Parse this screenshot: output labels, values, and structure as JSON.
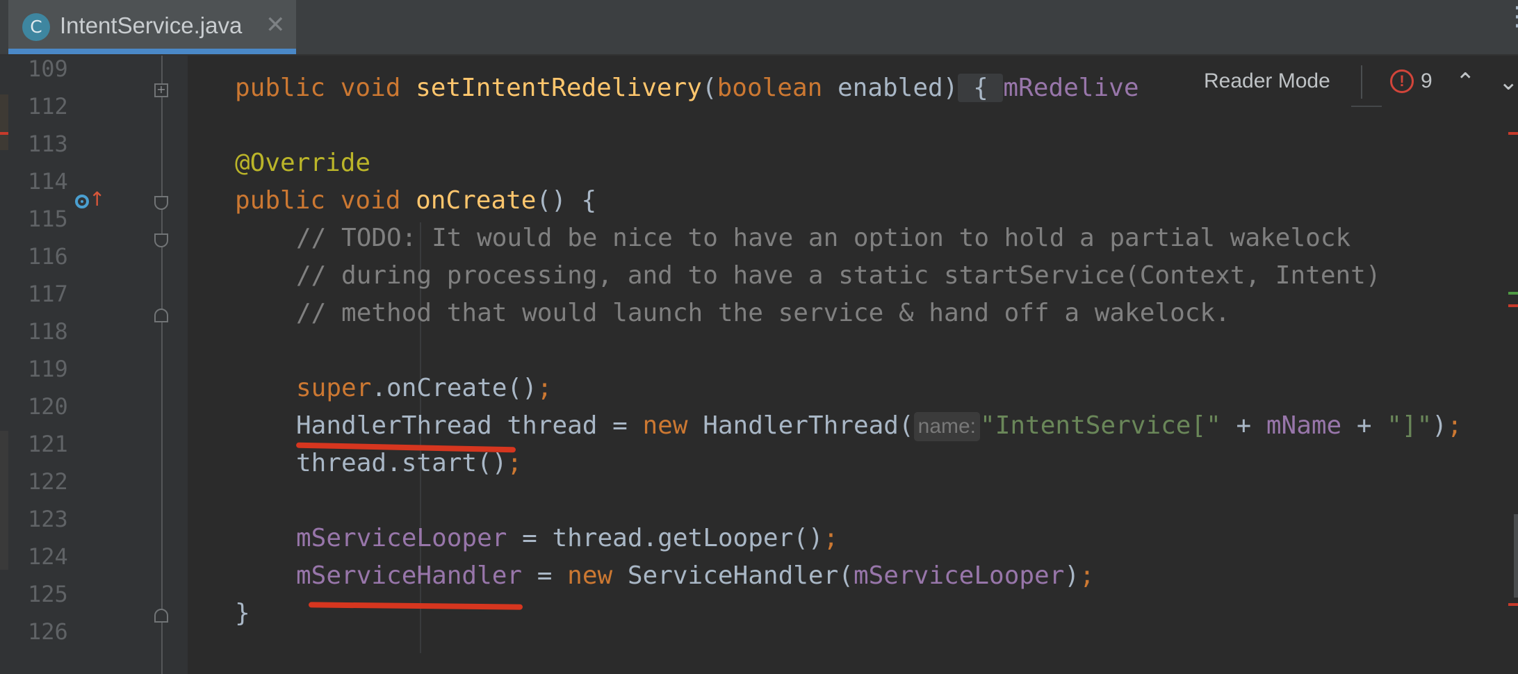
{
  "tab": {
    "icon_letter": "C",
    "title": "IntentService.java",
    "close_glyph": "✕"
  },
  "reader": {
    "label": "Reader Mode",
    "error_glyph": "!",
    "error_count": "9",
    "up_glyph": "⌃",
    "down_glyph": "⌄"
  },
  "more_glyph": "⋮",
  "gutter": {
    "line_numbers": [
      "109",
      "112",
      "113",
      "114",
      "115",
      "116",
      "117",
      "118",
      "119",
      "120",
      "121",
      "122",
      "123",
      "124",
      "125",
      "126"
    ]
  },
  "code": {
    "l109": {
      "kw1": "public void ",
      "fn": "setIntentRedelivery",
      "p1": "(",
      "kw2": "boolean",
      "p2": " enabled)",
      "brace": " { ",
      "fd": "mRedelive"
    },
    "l113": {
      "an": "@Override"
    },
    "l114": {
      "kw": "public void ",
      "fn": "onCreate",
      "rest": "() {"
    },
    "l115": {
      "cm": "// TODO: It would be nice to have an option to hold a partial wakelock"
    },
    "l116": {
      "cm": "// during processing, and to have a static startService(Context, Intent)"
    },
    "l117": {
      "cm": "// method that would launch the service & hand off a wakelock."
    },
    "l119": {
      "kw": "super",
      "rest": ".onCreate()",
      "semi": ";"
    },
    "l120": {
      "a": "HandlerThread thread = ",
      "kw": "new",
      "b": " HandlerThread(",
      "hint": "name:",
      "st1": "\"IntentService[\"",
      "c": " + ",
      "fd": "mName",
      "d": " + ",
      "st2": "\"]\"",
      "e": ")",
      "semi": ";"
    },
    "l121": {
      "a": "thread.start()",
      "semi": ";"
    },
    "l123": {
      "fd": "mServiceLooper",
      "a": " = thread.getLooper()",
      "semi": ";"
    },
    "l124": {
      "fd1": "mServiceHandler",
      "a": " = ",
      "kw": "new",
      "b": " ServiceHandler(",
      "fd2": "mServiceLooper",
      "c": ")",
      "semi": ";"
    },
    "l125": {
      "a": "}"
    }
  },
  "colors": {
    "keyword": "#cc7832",
    "method": "#ffc66d",
    "annotation": "#bbb529",
    "comment": "#808080",
    "field": "#9876aa",
    "string": "#6a8759",
    "text": "#a9b7c6",
    "background": "#2b2b2b",
    "tab_accent": "#4a88c7",
    "error": "#d2453a",
    "highlight_underline": "#d6361f"
  }
}
